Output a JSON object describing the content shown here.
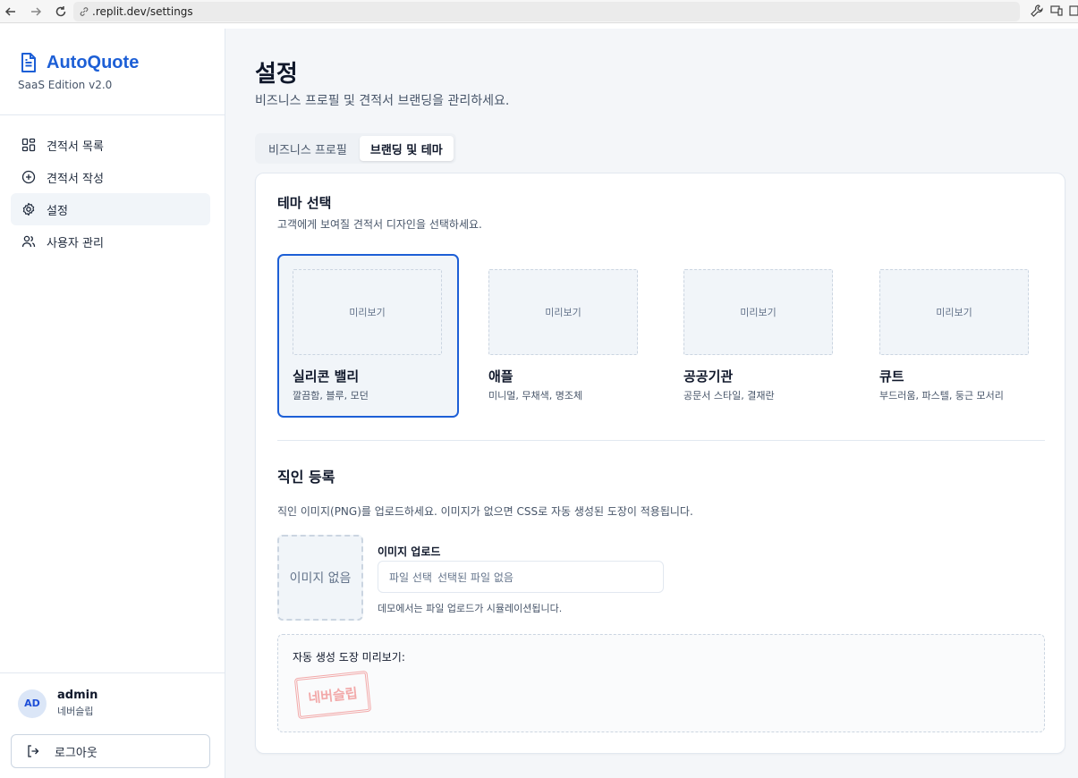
{
  "browser": {
    "url": ".replit.dev/settings"
  },
  "sidebar": {
    "brand": "AutoQuote",
    "edition": "SaaS Edition v2.0",
    "items": [
      {
        "label": "견적서 목록",
        "icon": "dashboard-icon",
        "active": false
      },
      {
        "label": "견적서 작성",
        "icon": "plus-circle-icon",
        "active": false
      },
      {
        "label": "설정",
        "icon": "gear-icon",
        "active": true
      },
      {
        "label": "사용자 관리",
        "icon": "users-icon",
        "active": false
      }
    ],
    "user": {
      "initials": "AD",
      "name": "admin",
      "org": "네버슬립"
    },
    "logout_label": "로그아웃"
  },
  "page": {
    "title": "설정",
    "subtitle": "비즈니스 프로필 및 견적서 브랜딩을 관리하세요.",
    "tabs": [
      {
        "label": "비즈니스 프로필",
        "active": false
      },
      {
        "label": "브랜딩 및 테마",
        "active": true
      }
    ]
  },
  "theme_section": {
    "title": "테마 선택",
    "subtitle": "고객에게 보여질 견적서 디자인을 선택하세요.",
    "preview_label": "미리보기",
    "themes": [
      {
        "name": "실리콘 밸리",
        "desc": "깔끔함, 블루, 모던",
        "selected": true
      },
      {
        "name": "애플",
        "desc": "미니멀, 무채색, 명조체",
        "selected": false
      },
      {
        "name": "공공기관",
        "desc": "공문서 스타일, 결재란",
        "selected": false
      },
      {
        "name": "큐트",
        "desc": "부드러움, 파스텔, 둥근 모서리",
        "selected": false
      }
    ]
  },
  "seal_section": {
    "title": "직인 등록",
    "subtitle": "직인 이미지(PNG)를 업로드하세요. 이미지가 없으면 CSS로 자동 생성된 도장이 적용됩니다.",
    "no_image": "이미지 없음",
    "upload_label": "이미지 업로드",
    "file_button": "파일 선택",
    "file_status": "선택된 파일 없음",
    "hint": "데모에서는 파일 업로드가 시뮬레이션됩니다.",
    "preview_label": "자동 생성 도장 미리보기:",
    "seal_text": "네버슬립"
  },
  "colors": {
    "accent": "#1d5fd6",
    "seal": "#f2a9a9"
  }
}
